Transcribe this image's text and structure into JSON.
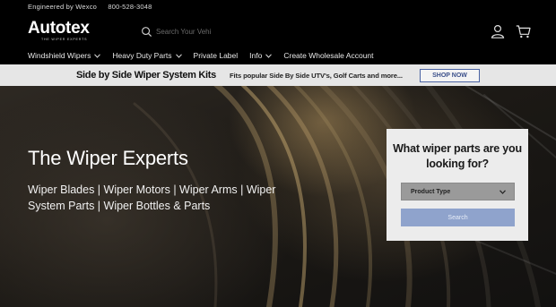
{
  "topbar": {
    "engineered": "Engineered by Wexco",
    "phone": "800-528-3048"
  },
  "logo": {
    "name": "Autotex",
    "tagline": "THE WIPER EXPERTS"
  },
  "search": {
    "placeholder": "Search Your Vehi"
  },
  "nav": {
    "items": [
      {
        "label": "Windshield Wipers"
      },
      {
        "label": "Heavy Duty Parts"
      },
      {
        "label": "Private Label"
      },
      {
        "label": "Info"
      },
      {
        "label": "Create Wholesale Account"
      }
    ]
  },
  "promo": {
    "title": "Side by Side Wiper System Kits",
    "subtitle": "Fits popular Side By Side UTV's, Golf Carts and more...",
    "button": "SHOP NOW"
  },
  "hero": {
    "title": "The Wiper Experts",
    "description": "Wiper Blades | Wiper Motors | Wiper Arms | Wiper System Parts | Wiper Bottles & Parts"
  },
  "finder": {
    "title": "What wiper parts are you looking for?",
    "select_value": "Product Type",
    "button": "Search"
  },
  "colors": {
    "promo_bg": "#e6e6e6",
    "accent": "#4a63a3",
    "finder_button": "#8fa3cc"
  }
}
